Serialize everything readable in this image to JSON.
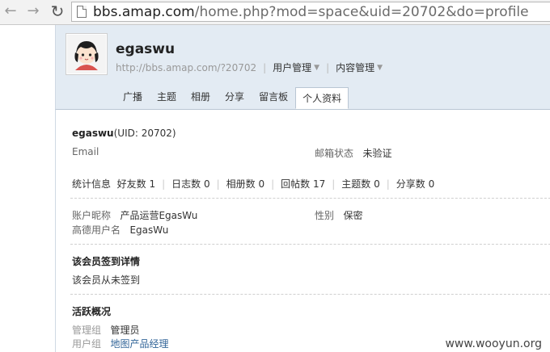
{
  "browser": {
    "url_host": "bbs.amap.com",
    "url_path": "/home.php?mod=space&uid=20702&do=profile"
  },
  "profile": {
    "username": "egaswu",
    "space_url": "http://bbs.amap.com/?20702",
    "menu_user": "用户管理",
    "menu_content": "内容管理"
  },
  "tabs": [
    "广播",
    "主题",
    "相册",
    "分享",
    "留言板",
    "个人资料"
  ],
  "info": {
    "name_uid": "egaswu",
    "uid_text": "(UID: 20702)",
    "email_label": "Email",
    "email_status_label": "邮箱状态",
    "email_status_value": "未验证",
    "stats_label": "统计信息",
    "stats": [
      "好友数 1",
      "日志数 0",
      "相册数 0",
      "回帖数 17",
      "主题数 0",
      "分享数 0"
    ],
    "nickname_label": "账户昵称",
    "nickname_value": "产品运营EgasWu",
    "gender_label": "性别",
    "gender_value": "保密",
    "amap_user_label": "高德用户名",
    "amap_user_value": "EgasWu"
  },
  "signin": {
    "title": "该会员签到详情",
    "text": "该会员从未签到"
  },
  "activity": {
    "title": "活跃概况",
    "admin_group_label": "管理组",
    "admin_group_value": "管理员",
    "user_group_label": "用户组",
    "user_group_value": "地图产品经理"
  },
  "watermark": "www.wooyun.org"
}
